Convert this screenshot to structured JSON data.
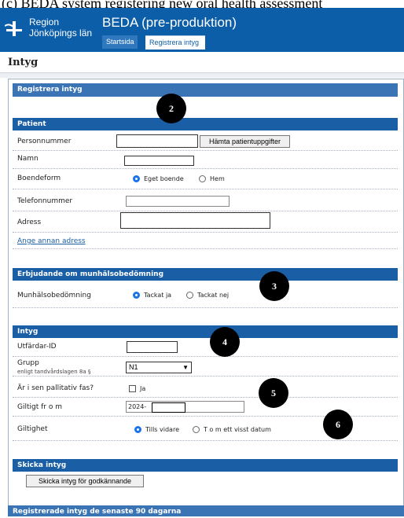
{
  "caption": "(c) BEDA system registering new oral health assessment",
  "header": {
    "brand_line1": "Region",
    "brand_line2": "Jönköpings län",
    "app_title": "BEDA (pre-produktion)",
    "tabs": [
      {
        "label": "Startsida"
      },
      {
        "label": "Registrera intyg"
      }
    ]
  },
  "page_title": "Intyg",
  "panel": {
    "title": "Registrera intyg",
    "patient": {
      "title": "Patient",
      "personnummer_label": "Personnummer",
      "fetch_button": "Hämta patientuppgifter",
      "namn_label": "Namn",
      "boendeform_label": "Boendeform",
      "boendeform_options": [
        {
          "label": "Eget boende",
          "selected": true
        },
        {
          "label": "Hem",
          "selected": false
        }
      ],
      "telefon_label": "Telefonnummer",
      "adress_label": "Adress",
      "other_address_link": "Ange annan adress"
    },
    "offer": {
      "title": "Erbjudande om munhälsobedömning",
      "label": "Munhälsobedömning",
      "options": [
        {
          "label": "Tackat ja",
          "selected": true
        },
        {
          "label": "Tackat nej",
          "selected": false
        }
      ]
    },
    "intyg": {
      "title": "Intyg",
      "utfardar_label": "Utfärdar-ID",
      "grupp_label": "Grupp",
      "grupp_sub": "enligt tandvårdslagen 8a §",
      "grupp_value": "N1",
      "palliativ_label": "Är i sen pallitativ fas?",
      "palliativ_option": "Ja",
      "giltigt_label": "Giltigt fr o m",
      "giltigt_value": "2024-",
      "giltighet_label": "Giltighet",
      "giltighet_options": [
        {
          "label": "Tills vidare",
          "selected": true
        },
        {
          "label": "T o m ett visst datum",
          "selected": false
        }
      ]
    },
    "send": {
      "title": "Skicka intyg",
      "button": "Skicka intyg för godkännande"
    },
    "recent_title": "Registrerade intyg de senaste 90 dagarna"
  },
  "markers": [
    "2",
    "3",
    "4",
    "5",
    "6"
  ]
}
